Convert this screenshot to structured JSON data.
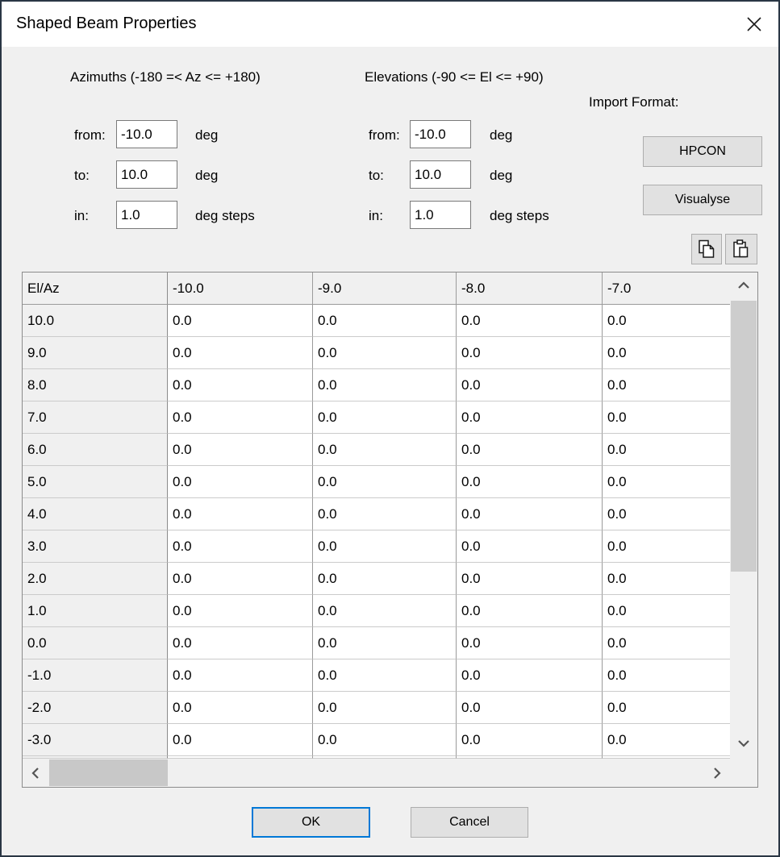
{
  "window": {
    "title": "Shaped Beam Properties"
  },
  "azimuth": {
    "heading": "Azimuths (-180 =< Az <= +180)",
    "rows": [
      {
        "label": "from:",
        "value": "-10.0",
        "unit": "deg"
      },
      {
        "label": "to:",
        "value": "10.0",
        "unit": "deg"
      },
      {
        "label": "in:",
        "value": "1.0",
        "unit": "deg steps"
      }
    ]
  },
  "elevation": {
    "heading": "Elevations (-90 <= El <= +90)",
    "rows": [
      {
        "label": "from:",
        "value": "-10.0",
        "unit": "deg"
      },
      {
        "label": "to:",
        "value": "10.0",
        "unit": "deg"
      },
      {
        "label": "in:",
        "value": "1.0",
        "unit": "deg steps"
      }
    ]
  },
  "import_format": {
    "label": "Import Format:",
    "buttons": [
      "HPCON",
      "Visualyse"
    ],
    "icons": [
      "copy-icon",
      "paste-icon"
    ]
  },
  "table": {
    "columns": [
      "El/Az",
      "-10.0",
      "-9.0",
      "-8.0",
      "-7.0"
    ],
    "rows": [
      {
        "label": "10.0",
        "values": [
          "0.0",
          "0.0",
          "0.0",
          "0.0"
        ]
      },
      {
        "label": "9.0",
        "values": [
          "0.0",
          "0.0",
          "0.0",
          "0.0"
        ]
      },
      {
        "label": "8.0",
        "values": [
          "0.0",
          "0.0",
          "0.0",
          "0.0"
        ]
      },
      {
        "label": "7.0",
        "values": [
          "0.0",
          "0.0",
          "0.0",
          "0.0"
        ]
      },
      {
        "label": "6.0",
        "values": [
          "0.0",
          "0.0",
          "0.0",
          "0.0"
        ]
      },
      {
        "label": "5.0",
        "values": [
          "0.0",
          "0.0",
          "0.0",
          "0.0"
        ]
      },
      {
        "label": "4.0",
        "values": [
          "0.0",
          "0.0",
          "0.0",
          "0.0"
        ]
      },
      {
        "label": "3.0",
        "values": [
          "0.0",
          "0.0",
          "0.0",
          "0.0"
        ]
      },
      {
        "label": "2.0",
        "values": [
          "0.0",
          "0.0",
          "0.0",
          "0.0"
        ]
      },
      {
        "label": "1.0",
        "values": [
          "0.0",
          "0.0",
          "0.0",
          "0.0"
        ]
      },
      {
        "label": "0.0",
        "values": [
          "0.0",
          "0.0",
          "0.0",
          "0.0"
        ]
      },
      {
        "label": "-1.0",
        "values": [
          "0.0",
          "0.0",
          "0.0",
          "0.0"
        ]
      },
      {
        "label": "-2.0",
        "values": [
          "0.0",
          "0.0",
          "0.0",
          "0.0"
        ]
      },
      {
        "label": "-3.0",
        "values": [
          "0.0",
          "0.0",
          "0.0",
          "0.0"
        ]
      }
    ]
  },
  "footer": {
    "ok_label": "OK",
    "cancel_label": "Cancel"
  },
  "colors": {
    "accent_blue": "#0078d7",
    "dialog_border": "#2a3644",
    "content_bg": "#f0f0f0",
    "button_bg": "#e1e1e1",
    "scrollbar_thumb": "#cdcdcd"
  }
}
